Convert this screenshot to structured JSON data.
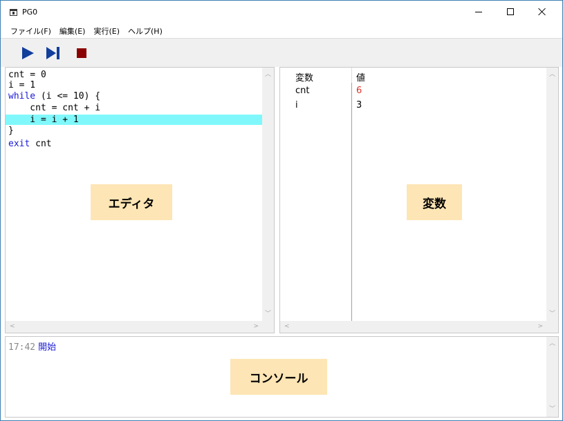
{
  "window": {
    "title": "PG0",
    "controls": {
      "minimize": "minimize-icon",
      "maximize": "maximize-icon",
      "close": "close-icon"
    }
  },
  "menu": {
    "items": [
      {
        "label": "ファイル(F)"
      },
      {
        "label": "編集(E)"
      },
      {
        "label": "実行(E)"
      },
      {
        "label": "ヘルプ(H)"
      }
    ]
  },
  "toolbar": {
    "buttons": [
      {
        "icon": "play-icon",
        "color": "#123e9c"
      },
      {
        "icon": "step-icon",
        "color": "#123e9c"
      },
      {
        "icon": "stop-icon",
        "color": "#8b0000"
      }
    ]
  },
  "editor": {
    "highlight_color": "#80f8fb",
    "keyword_color": "#1a1ad6",
    "lines": [
      {
        "text": "cnt = 0",
        "kw": "",
        "rest": "cnt = 0"
      },
      {
        "text": "i = 1",
        "kw": "",
        "rest": "i = 1"
      },
      {
        "text": "while (i <= 10) {",
        "kw": "while",
        "rest": " (i <= 10) {"
      },
      {
        "text": "    cnt = cnt + i",
        "kw": "",
        "rest": "    cnt = cnt + i"
      },
      {
        "text": "    i = i + 1",
        "kw": "",
        "rest": "    i = i + 1",
        "highlighted": true
      },
      {
        "text": "}",
        "kw": "",
        "rest": "}"
      },
      {
        "text": "exit cnt",
        "kw": "exit",
        "rest": " cnt"
      }
    ],
    "label": "エディタ"
  },
  "variables": {
    "header": {
      "name": "変数",
      "value": "値"
    },
    "rows": [
      {
        "name": "cnt",
        "value": "6",
        "value_color": "#e0332a"
      },
      {
        "name": "i",
        "value": "3",
        "value_color": "#000000"
      }
    ],
    "label": "変数"
  },
  "console": {
    "lines": [
      {
        "time": "17:42",
        "message": "開始"
      }
    ],
    "label": "コンソール"
  }
}
